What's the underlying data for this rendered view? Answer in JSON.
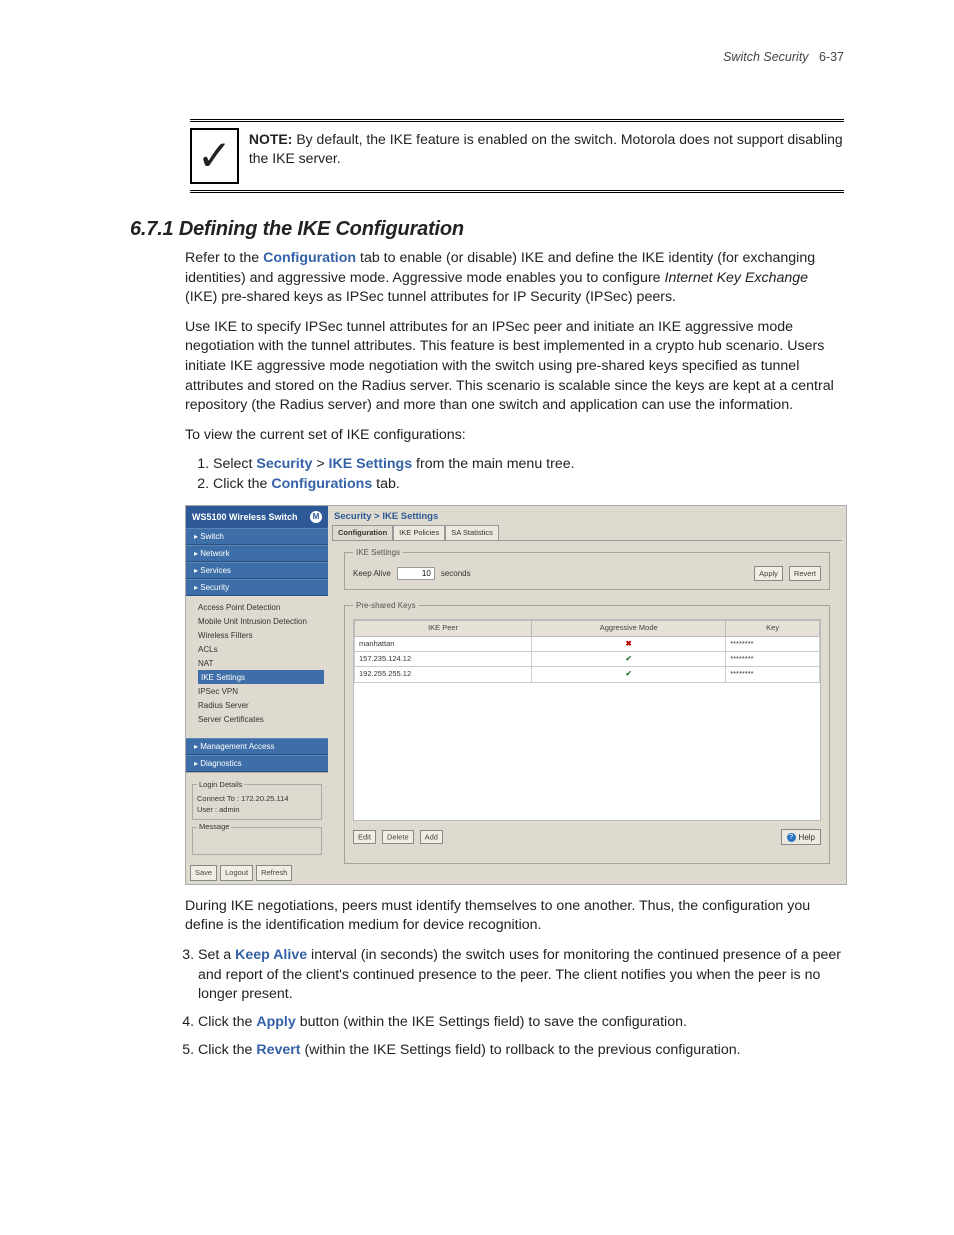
{
  "header": {
    "title": "Switch Security",
    "page": "6-37"
  },
  "note": {
    "label": "NOTE:",
    "text": "By default, the IKE feature is enabled on the switch. Motorola does not support disabling the IKE server."
  },
  "section": {
    "number": "6.7.1",
    "title": "Defining the IKE Configuration"
  },
  "para1_a": "Refer to the ",
  "para1_link": "Configuration",
  "para1_b": " tab to enable (or disable) IKE and define the IKE identity (for exchanging identities) and aggressive mode. Aggressive mode enables you to configure ",
  "para1_em": "Internet Key Exchange",
  "para1_c": " (IKE) pre-shared keys as IPSec tunnel attributes for IP Security (IPSec) peers.",
  "para2": "Use IKE to specify IPSec tunnel attributes for an IPSec peer and initiate an IKE aggressive mode negotiation with the tunnel attributes. This feature is best implemented in a crypto hub scenario. Users initiate IKE aggressive mode negotiation with the switch using pre-shared keys specified as tunnel attributes and stored on the Radius server. This scenario is scalable since the keys are kept at a central repository (the Radius server) and more than one switch and application can use the information.",
  "para3": "To view the current set of IKE configurations:",
  "steps12": [
    {
      "n": "1.",
      "a": "Select ",
      "l1": "Security",
      "sep": " > ",
      "l2": "IKE Settings",
      "b": " from the main menu tree."
    },
    {
      "n": "2.",
      "a": "Click the ",
      "l1": "Configurations",
      "b": " tab."
    }
  ],
  "screenshot": {
    "sidebar_title": "WS5100 Wireless Switch",
    "nav": [
      "Switch",
      "Network",
      "Services",
      "Security"
    ],
    "nav2": [
      "Management Access",
      "Diagnostics"
    ],
    "sub": [
      "Access Point Detection",
      "Mobile Unit Intrusion Detection",
      "Wireless Filters",
      "ACLs",
      "NAT",
      "IKE Settings",
      "IPSec VPN",
      "Radius Server",
      "Server Certificates"
    ],
    "login": {
      "legend": "Login Details",
      "connect_label": "Connect To :",
      "connect": "172.20.25.114",
      "user_label": "User :",
      "user": "admin"
    },
    "msg_legend": "Message",
    "bottom_btns": [
      "Save",
      "Logout",
      "Refresh"
    ],
    "breadcrumb": "Security > IKE Settings",
    "tabs": [
      "Configuration",
      "IKE Policies",
      "SA Statistics"
    ],
    "ike_legend": "IKE Settings",
    "keep_alive_label": "Keep Alive",
    "keep_alive_value": "10",
    "keep_alive_unit": "seconds",
    "apply": "Apply",
    "revert": "Revert",
    "psk_legend": "Pre-shared Keys",
    "cols": [
      "IKE Peer",
      "Aggressive Mode",
      "Key"
    ],
    "rows": [
      {
        "peer": "manhattan",
        "mode": "x",
        "key": "********"
      },
      {
        "peer": "157.235.124.12",
        "mode": "v",
        "key": "********"
      },
      {
        "peer": "192.255.255.12",
        "mode": "v",
        "key": "********"
      }
    ],
    "actions": [
      "Edit",
      "Delete",
      "Add"
    ],
    "help": "Help"
  },
  "para4": "During IKE negotiations, peers must identify themselves to one another. Thus, the configuration you define is the identification medium for device recognition.",
  "steps35": [
    {
      "n": "3.",
      "a": "Set a ",
      "l": "Keep Alive",
      "b": " interval (in seconds) the switch uses for monitoring the continued presence of a peer and report of the client's continued presence to the peer. The client notifies you when the peer is no longer present."
    },
    {
      "n": "4.",
      "a": "Click the ",
      "l": "Apply",
      "b": " button (within the IKE Settings field) to save the configuration."
    },
    {
      "n": "5.",
      "a": "Click the ",
      "l": "Revert",
      "b": " (within the IKE Settings field) to rollback to the previous configuration."
    }
  ]
}
